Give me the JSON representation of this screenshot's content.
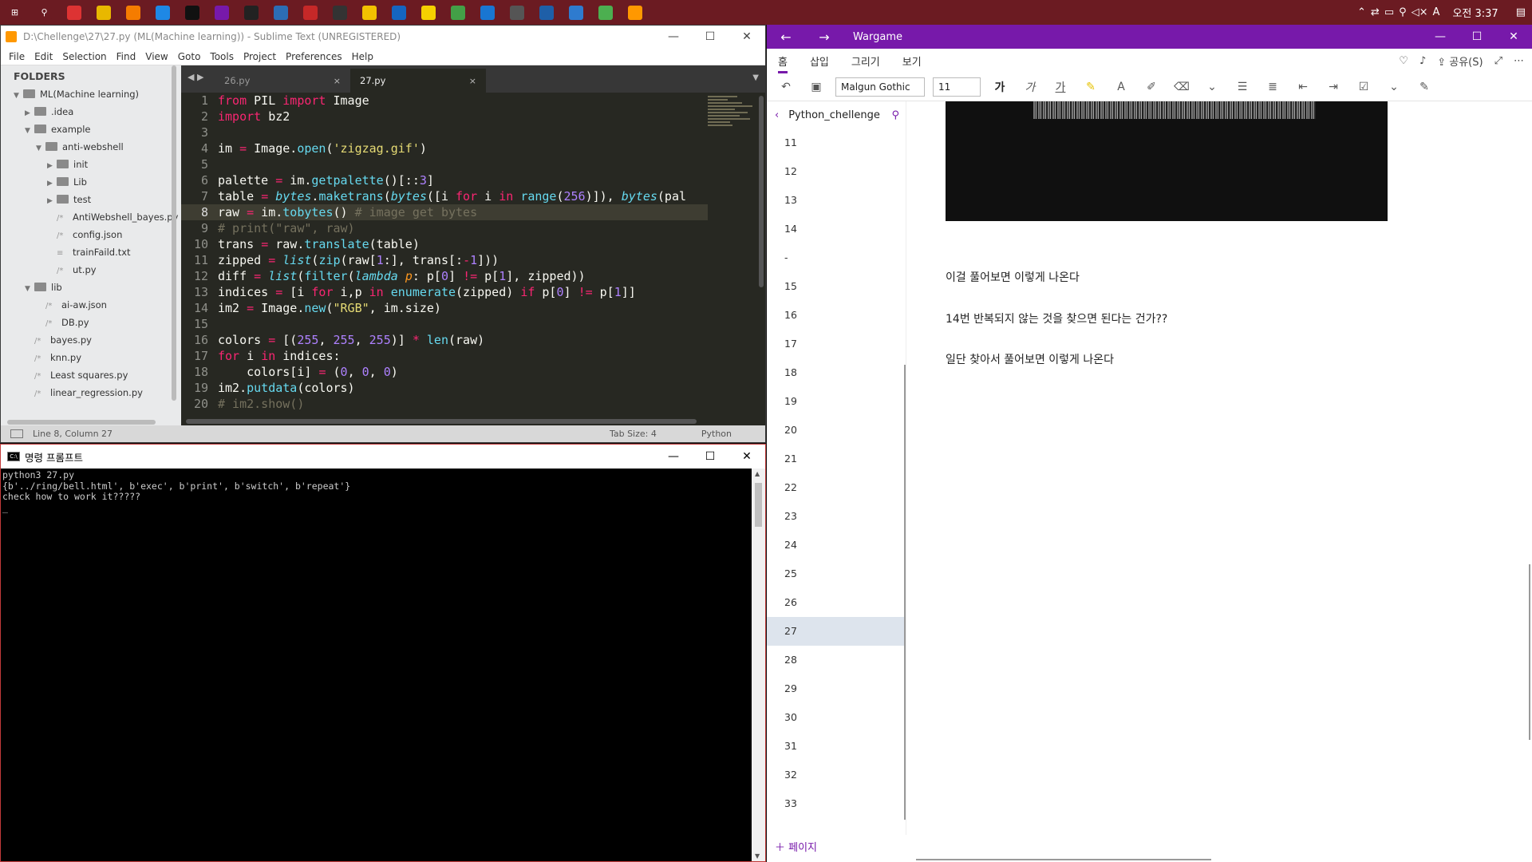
{
  "taskbar": {
    "apps": [
      "windows-logo",
      "search",
      "chrome",
      "file-explorer",
      "search-tool",
      "edge",
      "pycharm",
      "onenote",
      "cmd",
      "terminal",
      "sublime-red",
      "github",
      "sticky-notes",
      "maps",
      "kakaotalk",
      "app-green",
      "app-blue",
      "app-gray",
      "app-screen",
      "app-blue2",
      "app-globe",
      "sublime"
    ],
    "tray": {
      "ime": "A",
      "time": "오전 3:37"
    }
  },
  "sublime": {
    "title": "D:\\Chellenge\\27\\27.py (ML(Machine learning)) - Sublime Text (UNREGISTERED)",
    "menu": [
      "File",
      "Edit",
      "Selection",
      "Find",
      "View",
      "Goto",
      "Tools",
      "Project",
      "Preferences",
      "Help"
    ],
    "folders_header": "FOLDERS",
    "tree": [
      {
        "label": "ML(Machine learning)",
        "type": "folder",
        "depth": 0,
        "arrow": "▼"
      },
      {
        "label": ".idea",
        "type": "folder",
        "depth": 1,
        "arrow": "▶"
      },
      {
        "label": "example",
        "type": "folder",
        "depth": 1,
        "arrow": "▼"
      },
      {
        "label": "anti-webshell",
        "type": "folder",
        "depth": 2,
        "arrow": "▼"
      },
      {
        "label": "init",
        "type": "folder",
        "depth": 3,
        "arrow": "▶"
      },
      {
        "label": "Lib",
        "type": "folder",
        "depth": 3,
        "arrow": "▶"
      },
      {
        "label": "test",
        "type": "folder",
        "depth": 3,
        "arrow": "▶"
      },
      {
        "label": "AntiWebshell_bayes.py",
        "type": "file",
        "depth": 3,
        "icon": "/*"
      },
      {
        "label": "config.json",
        "type": "file",
        "depth": 3,
        "icon": "/*"
      },
      {
        "label": "trainFaild.txt",
        "type": "file",
        "depth": 3,
        "icon": "≡"
      },
      {
        "label": "ut.py",
        "type": "file",
        "depth": 3,
        "icon": "/*"
      },
      {
        "label": "lib",
        "type": "folder",
        "depth": 1,
        "arrow": "▼"
      },
      {
        "label": "ai-aw.json",
        "type": "file",
        "depth": 2,
        "icon": "/*"
      },
      {
        "label": "DB.py",
        "type": "file",
        "depth": 2,
        "icon": "/*"
      },
      {
        "label": "bayes.py",
        "type": "file",
        "depth": 1,
        "icon": "/*"
      },
      {
        "label": "knn.py",
        "type": "file",
        "depth": 1,
        "icon": "/*"
      },
      {
        "label": "Least squares.py",
        "type": "file",
        "depth": 1,
        "icon": "/*"
      },
      {
        "label": "linear_regression.py",
        "type": "file",
        "depth": 1,
        "icon": "/*"
      }
    ],
    "tabs": [
      {
        "label": "26.py",
        "active": false
      },
      {
        "label": "27.py",
        "active": true
      }
    ],
    "close_glyph": "×",
    "code": [
      [
        [
          "kw",
          "from"
        ],
        [
          "ct",
          " PIL "
        ],
        [
          "kw",
          "import"
        ],
        [
          "ct",
          " Image"
        ]
      ],
      [
        [
          "kw",
          "import"
        ],
        [
          "ct",
          " bz2"
        ]
      ],
      [],
      [
        [
          "ct",
          "im "
        ],
        [
          "kw",
          "="
        ],
        [
          "ct",
          " Image."
        ],
        [
          "fn",
          "open"
        ],
        [
          "ct",
          "("
        ],
        [
          "st",
          "'zigzag.gif'"
        ],
        [
          "ct",
          ")"
        ]
      ],
      [],
      [
        [
          "ct",
          "palette "
        ],
        [
          "kw",
          "="
        ],
        [
          "ct",
          " im."
        ],
        [
          "fn",
          "getpalette"
        ],
        [
          "ct",
          "()[::"
        ],
        [
          "nu",
          "3"
        ],
        [
          "ct",
          "]"
        ]
      ],
      [
        [
          "ct",
          "table "
        ],
        [
          "kw",
          "="
        ],
        [
          "ct",
          " "
        ],
        [
          "it",
          "bytes"
        ],
        [
          "ct",
          "."
        ],
        [
          "fn",
          "maketrans"
        ],
        [
          "ct",
          "("
        ],
        [
          "it",
          "bytes"
        ],
        [
          "ct",
          "([i "
        ],
        [
          "kw",
          "for"
        ],
        [
          "ct",
          " i "
        ],
        [
          "kw",
          "in"
        ],
        [
          "ct",
          " "
        ],
        [
          "fn",
          "range"
        ],
        [
          "ct",
          "("
        ],
        [
          "nu",
          "256"
        ],
        [
          "ct",
          ")]), "
        ],
        [
          "it",
          "bytes"
        ],
        [
          "ct",
          "(pal"
        ]
      ],
      [
        [
          "ct",
          "raw "
        ],
        [
          "kw",
          "="
        ],
        [
          "ct",
          " im."
        ],
        [
          "fn",
          "tobytes"
        ],
        [
          "ct",
          "() "
        ],
        [
          "cm",
          "# image get bytes"
        ]
      ],
      [
        [
          "cm",
          "# print(\"raw\", raw)"
        ]
      ],
      [
        [
          "ct",
          "trans "
        ],
        [
          "kw",
          "="
        ],
        [
          "ct",
          " raw."
        ],
        [
          "fn",
          "translate"
        ],
        [
          "ct",
          "(table)"
        ]
      ],
      [
        [
          "ct",
          "zipped "
        ],
        [
          "kw",
          "="
        ],
        [
          "ct",
          " "
        ],
        [
          "it",
          "list"
        ],
        [
          "ct",
          "("
        ],
        [
          "fn",
          "zip"
        ],
        [
          "ct",
          "(raw["
        ],
        [
          "nu",
          "1"
        ],
        [
          "ct",
          ":], trans[:"
        ],
        [
          "kw",
          "-"
        ],
        [
          "nu",
          "1"
        ],
        [
          "ct",
          "]))"
        ]
      ],
      [
        [
          "ct",
          "diff "
        ],
        [
          "kw",
          "="
        ],
        [
          "ct",
          " "
        ],
        [
          "it",
          "list"
        ],
        [
          "ct",
          "("
        ],
        [
          "fn",
          "filter"
        ],
        [
          "ct",
          "("
        ],
        [
          "it",
          "lambda"
        ],
        [
          "ct",
          " "
        ],
        [
          "pa",
          "p"
        ],
        [
          "ct",
          ": p["
        ],
        [
          "nu",
          "0"
        ],
        [
          "ct",
          "] "
        ],
        [
          "kw",
          "!="
        ],
        [
          "ct",
          " p["
        ],
        [
          "nu",
          "1"
        ],
        [
          "ct",
          "], zipped))"
        ]
      ],
      [
        [
          "ct",
          "indices "
        ],
        [
          "kw",
          "="
        ],
        [
          "ct",
          " [i "
        ],
        [
          "kw",
          "for"
        ],
        [
          "ct",
          " i,p "
        ],
        [
          "kw",
          "in"
        ],
        [
          "ct",
          " "
        ],
        [
          "fn",
          "enumerate"
        ],
        [
          "ct",
          "(zipped) "
        ],
        [
          "kw",
          "if"
        ],
        [
          "ct",
          " p["
        ],
        [
          "nu",
          "0"
        ],
        [
          "ct",
          "] "
        ],
        [
          "kw",
          "!="
        ],
        [
          "ct",
          " p["
        ],
        [
          "nu",
          "1"
        ],
        [
          "ct",
          "]]"
        ]
      ],
      [
        [
          "ct",
          "im2 "
        ],
        [
          "kw",
          "="
        ],
        [
          "ct",
          " Image."
        ],
        [
          "fn",
          "new"
        ],
        [
          "ct",
          "("
        ],
        [
          "st",
          "\"RGB\""
        ],
        [
          "ct",
          ", im.size)"
        ]
      ],
      [],
      [
        [
          "ct",
          "colors "
        ],
        [
          "kw",
          "="
        ],
        [
          "ct",
          " [("
        ],
        [
          "nu",
          "255"
        ],
        [
          "ct",
          ", "
        ],
        [
          "nu",
          "255"
        ],
        [
          "ct",
          ", "
        ],
        [
          "nu",
          "255"
        ],
        [
          "ct",
          ")] "
        ],
        [
          "kw",
          "*"
        ],
        [
          "ct",
          " "
        ],
        [
          "fn",
          "len"
        ],
        [
          "ct",
          "(raw)"
        ]
      ],
      [
        [
          "kw",
          "for"
        ],
        [
          "ct",
          " i "
        ],
        [
          "kw",
          "in"
        ],
        [
          "ct",
          " indices:"
        ]
      ],
      [
        [
          "ct",
          "    colors[i] "
        ],
        [
          "kw",
          "="
        ],
        [
          "ct",
          " ("
        ],
        [
          "nu",
          "0"
        ],
        [
          "ct",
          ", "
        ],
        [
          "nu",
          "0"
        ],
        [
          "ct",
          ", "
        ],
        [
          "nu",
          "0"
        ],
        [
          "ct",
          ")"
        ]
      ],
      [
        [
          "ct",
          "im2."
        ],
        [
          "fn",
          "putdata"
        ],
        [
          "ct",
          "(colors)"
        ]
      ],
      [
        [
          "cm",
          "# im2.show()"
        ]
      ]
    ],
    "active_line": 8,
    "status": {
      "position": "Line 8, Column 27",
      "tab_size": "Tab Size: 4",
      "syntax": "Python"
    }
  },
  "cmd": {
    "title": "명령 프롬프트",
    "output": "python3 27.py\n{b'../ring/bell.html', b'exec', b'print', b'switch', b'repeat'}\ncheck how to work it?????\n_"
  },
  "onenote": {
    "title": "Wargame",
    "ribbon_tabs": [
      "홈",
      "삽입",
      "그리기",
      "보기"
    ],
    "share_label": "공유(S)",
    "font_name": "Malgun Gothic",
    "font_size": "11",
    "toolbar_glyphs": [
      "가",
      "가",
      "가"
    ],
    "section_name": "Python_chellenge",
    "pages": [
      "11",
      "12",
      "13",
      "14",
      "-",
      "15",
      "16",
      "17",
      "18",
      "19",
      "20",
      "21",
      "22",
      "23",
      "24",
      "25",
      "26",
      "27",
      "28",
      "29",
      "30",
      "31",
      "32",
      "33"
    ],
    "selected_page": "27",
    "add_page": "페이지",
    "paragraphs": [
      "이걸 풀어보면 이렇게 나온다",
      "14번 반복되지 않는 것을 찾으면 된다는 건가??",
      "일단 찾아서 풀어보면 이렇게 나온다"
    ],
    "accent_color": "#7719aa"
  }
}
